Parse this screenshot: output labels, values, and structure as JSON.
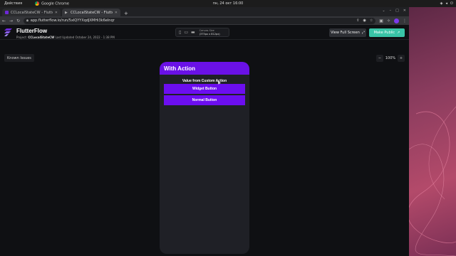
{
  "os": {
    "activities": "Действия",
    "app": "Google Chrome",
    "clock": "пн, 24 окт 16:00"
  },
  "browser": {
    "tabs": [
      {
        "title": "CCLocalStateCW - Flutter",
        "active": false
      },
      {
        "title": "CCLocalStateCW - Flutte",
        "active": true
      }
    ],
    "url": "app.flutterflow.io/run/5xlQYYXqdJXMHi3k6eInqr"
  },
  "flutterflow": {
    "brand": "FlutterFlow",
    "project_label": "Project:",
    "project_name": "CCLocalStateCW",
    "last_updated": "Last Updated October 24, 2022 - 1:38 PM",
    "canvas_size_label": "Canvas Size",
    "canvas_size_value": "(375px x 812px)",
    "view_full_screen": "View Full Screen",
    "make_public": "Make Public",
    "known_issues": "Known Issues",
    "zoom_minus": "−",
    "zoom_value": "100%",
    "zoom_plus": "+"
  },
  "app_preview": {
    "title": "With Action",
    "value_text": "Value from Custom Action",
    "widget_button": "Widget Button",
    "normal_button": "Normal Button"
  },
  "colors": {
    "accent_purple": "#6a11e6",
    "publish_teal": "#39c4a7"
  }
}
